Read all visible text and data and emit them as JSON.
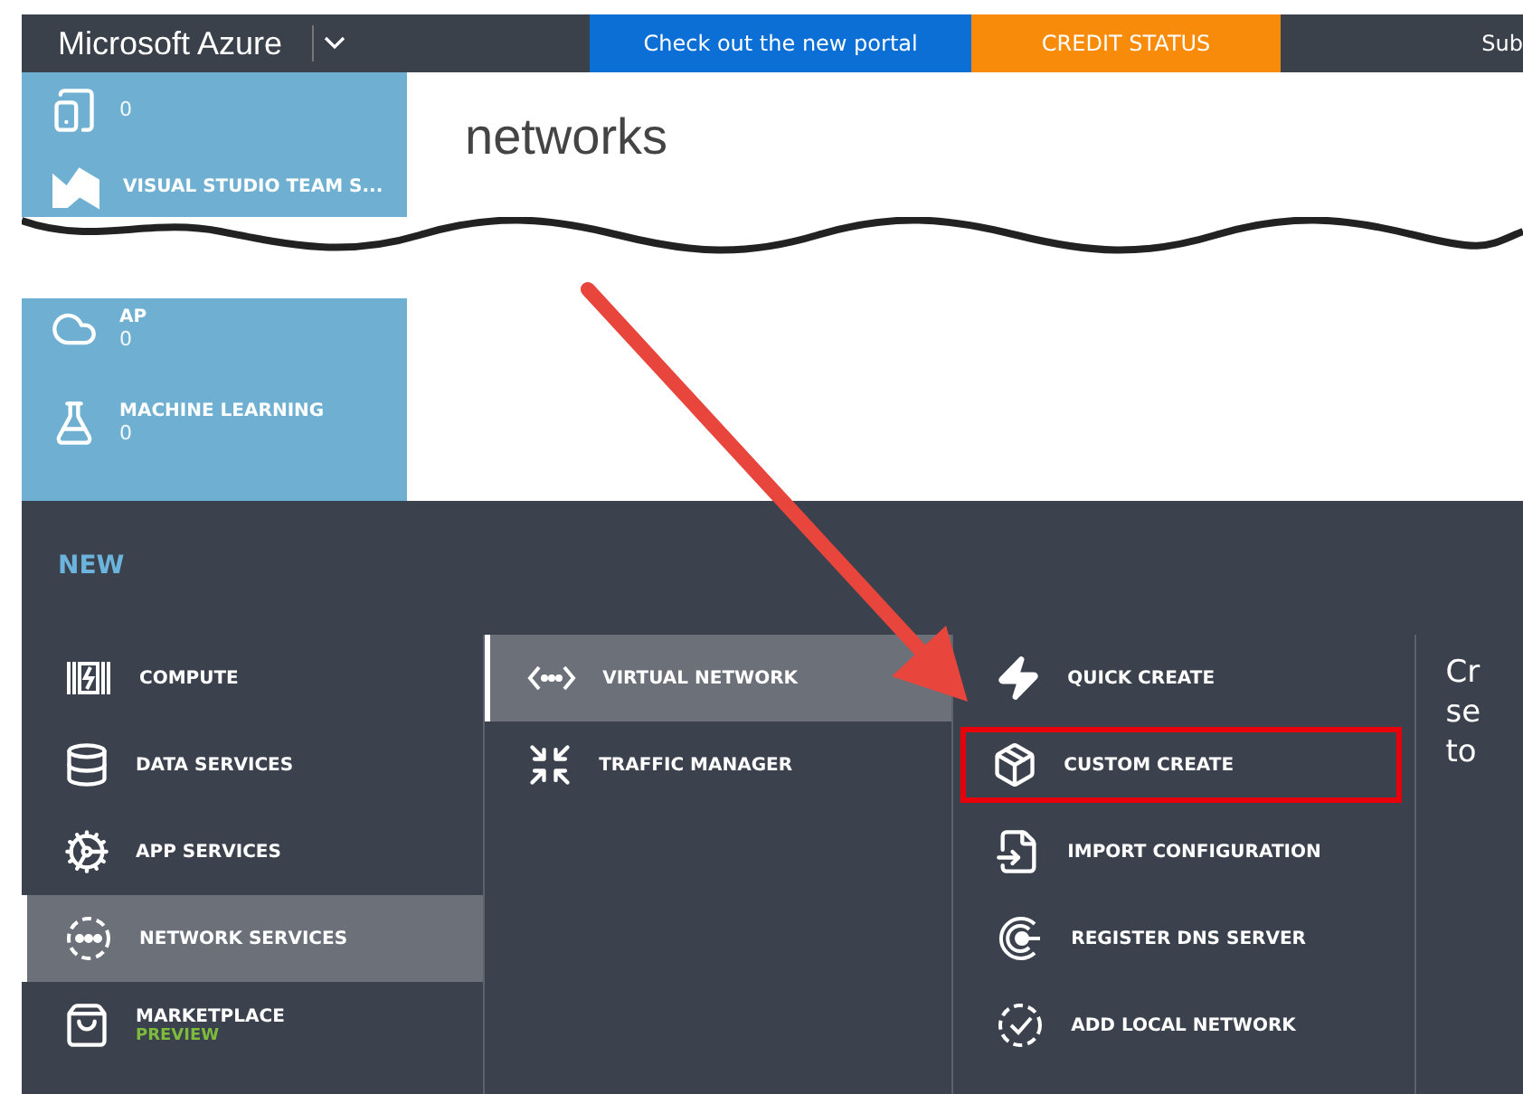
{
  "header": {
    "brand": "Microsoft Azure",
    "promo_link": "Check out the new portal",
    "credit_button": "CREDIT STATUS",
    "subscriptions": "Sub"
  },
  "sidebar_top": [
    {
      "count": "0"
    },
    {
      "name": "VISUAL STUDIO TEAM S..."
    }
  ],
  "page_title": "networks",
  "sidebar_bottom": [
    {
      "name": "AP",
      "count": "0"
    },
    {
      "name": "MACHINE LEARNING",
      "count": "0"
    }
  ],
  "new_panel": {
    "title": "NEW",
    "categories": [
      {
        "label": "COMPUTE",
        "selected": false
      },
      {
        "label": "DATA SERVICES",
        "selected": false
      },
      {
        "label": "APP SERVICES",
        "selected": false
      },
      {
        "label": "NETWORK SERVICES",
        "selected": true
      },
      {
        "label": "MARKETPLACE",
        "badge": "PREVIEW",
        "selected": false
      }
    ],
    "services": [
      {
        "label": "VIRTUAL NETWORK",
        "selected": true
      },
      {
        "label": "TRAFFIC MANAGER",
        "selected": false
      }
    ],
    "actions": [
      {
        "label": "QUICK CREATE",
        "highlighted": false
      },
      {
        "label": "CUSTOM CREATE",
        "highlighted": true
      },
      {
        "label": "IMPORT CONFIGURATION",
        "highlighted": false
      },
      {
        "label": "REGISTER DNS SERVER",
        "highlighted": false
      },
      {
        "label": "ADD LOCAL NETWORK",
        "highlighted": false
      }
    ],
    "description_lines": [
      "Cr",
      "se",
      "to"
    ]
  }
}
